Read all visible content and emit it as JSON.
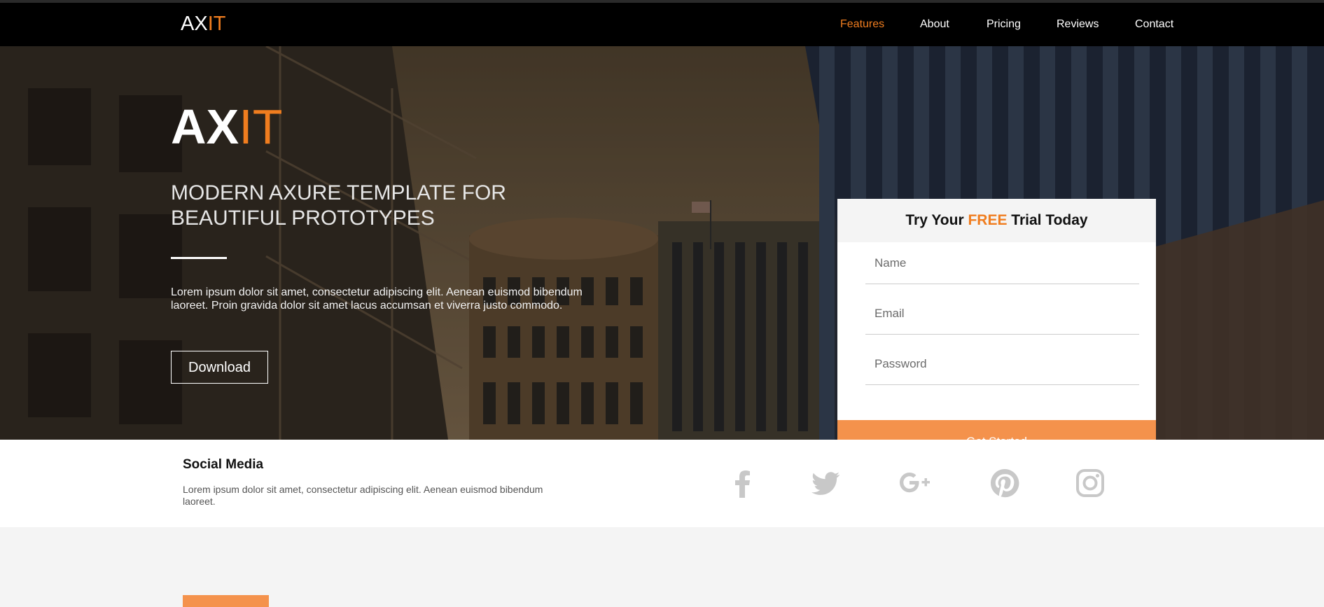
{
  "brand": {
    "name_main": "AX",
    "name_accent": "IT",
    "accent_color": "#f07d1f"
  },
  "nav": {
    "items": [
      {
        "label": "Features",
        "active": true
      },
      {
        "label": "About",
        "active": false
      },
      {
        "label": "Pricing",
        "active": false
      },
      {
        "label": "Reviews",
        "active": false
      },
      {
        "label": "Contact",
        "active": false
      }
    ]
  },
  "hero": {
    "title": "MODERN AXURE TEMPLATE FOR BEAUTIFUL PROTOTYPES",
    "text": "Lorem ipsum dolor sit amet, consectetur adipiscing elit. Aenean euismod bibendum laoreet. Proin gravida dolor sit amet lacus accumsan et viverra justo commodo.",
    "download_label": "Download"
  },
  "form": {
    "heading_pre": "Try Your ",
    "heading_free": "FREE",
    "heading_post": " Trial Today",
    "name_placeholder": "Name",
    "email_placeholder": "Email",
    "password_placeholder": "Password",
    "submit_label": "Get Started",
    "button_color": "#f4924c"
  },
  "social": {
    "title": "Social Media",
    "text": "Lorem ipsum dolor sit amet, consectetur adipiscing elit. Aenean euismod bibendum laoreet.",
    "icons": [
      "facebook-icon",
      "twitter-icon",
      "google-plus-icon",
      "pinterest-icon",
      "instagram-icon"
    ],
    "icon_color": "#c8c8c8"
  }
}
